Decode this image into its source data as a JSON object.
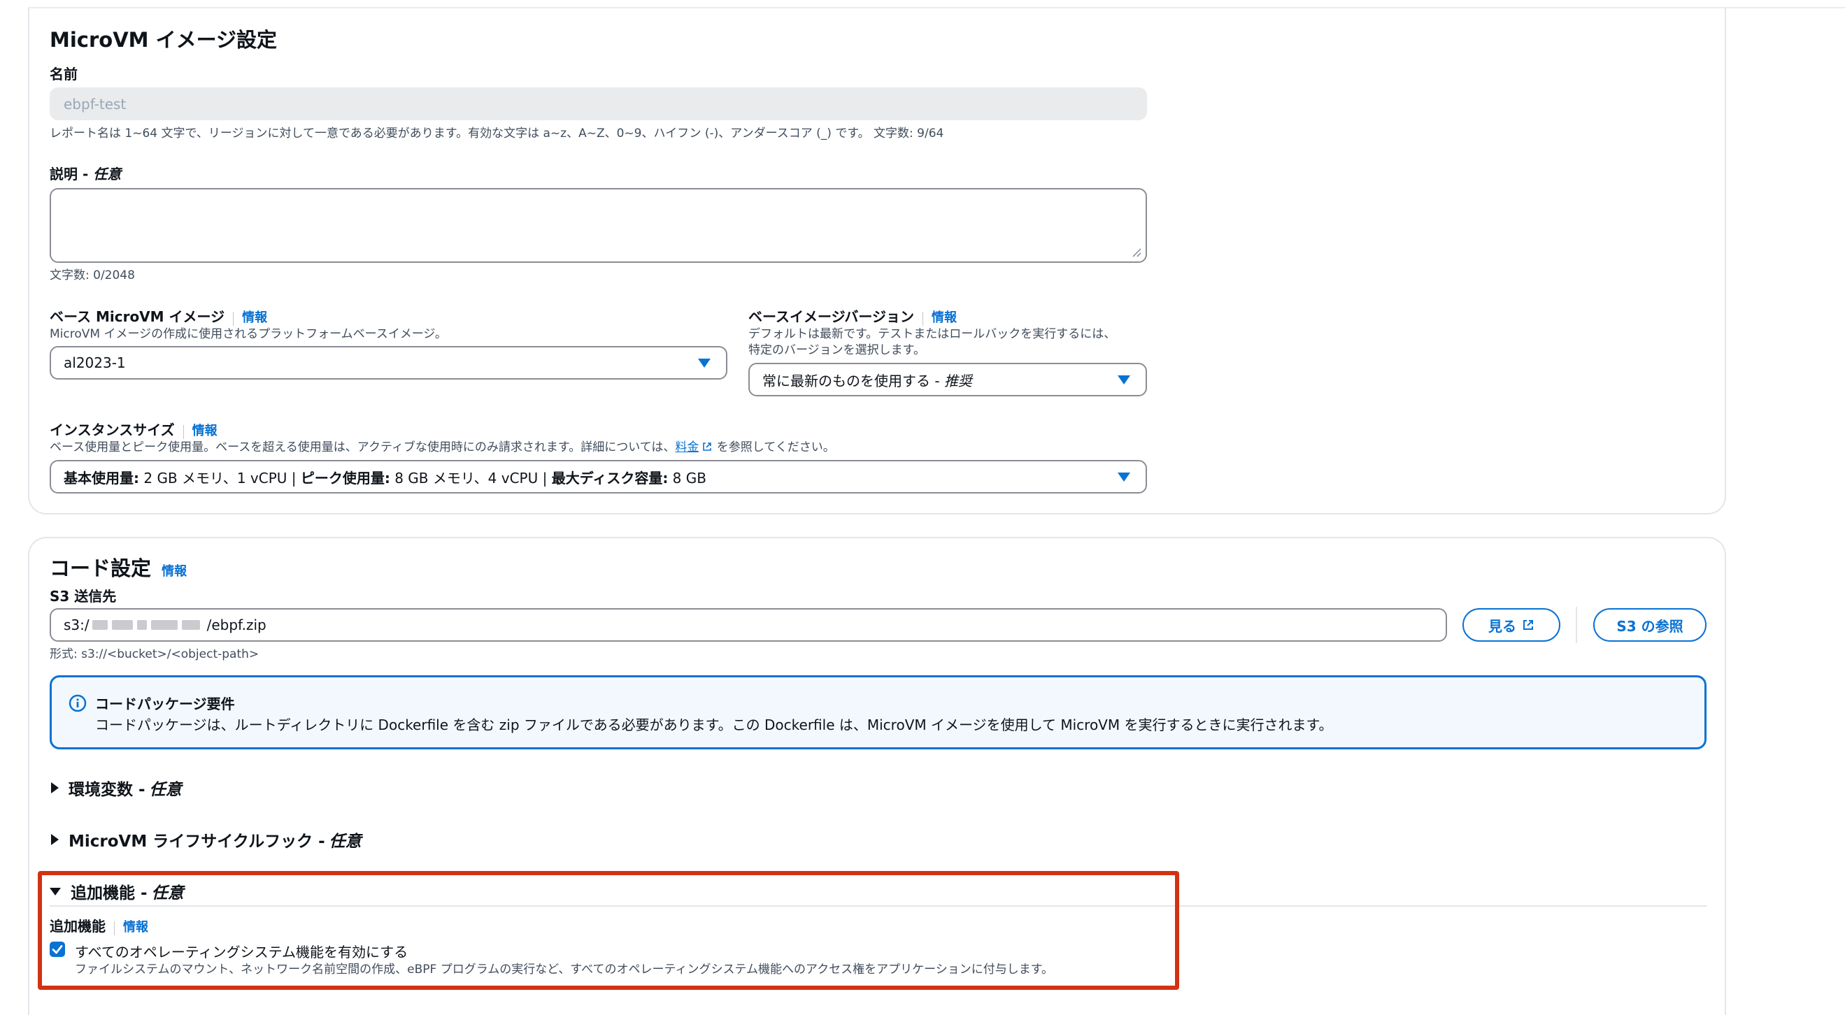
{
  "image_settings": {
    "title": "MicroVM イメージ設定",
    "name_label": "名前",
    "name_value": "ebpf-test",
    "name_hint": "レポート名は 1~64 文字で、リージョンに対して一意である必要があります。有効な文字は a~z、A~Z、0~9、ハイフン (-)、アンダースコア (_) です。 文字数: 9/64",
    "description_label": "説明 - ",
    "description_optional": "任意",
    "description_count": "文字数: 0/2048",
    "base_image_label": "ベース MicroVM イメージ",
    "base_image_info": "情報",
    "base_image_desc": "MicroVM イメージの作成に使用されるプラットフォームベースイメージ。",
    "base_image_value": "al2023-1",
    "base_version_label": "ベースイメージバージョン",
    "base_version_info": "情報",
    "base_version_desc_1": "デフォルトは最新です。テストまたはロールバックを実行するには、",
    "base_version_desc_2": "特定のバージョンを選択します。",
    "base_version_value": "常に最新のものを使用する - ",
    "base_version_value_italic": "推奨",
    "instance_size_label": "インスタンスサイズ",
    "instance_size_info": "情報",
    "instance_size_desc_pre": "ベース使用量とピーク使用量。ベースを超える使用量は、アクティブな使用時にのみ請求されます。詳細については、",
    "instance_size_link": "料金",
    "instance_size_desc_post": " を参照してください。",
    "instance_size_value": {
      "base_label": "基本使用量:",
      "base_value": " 2 GB メモリ、1 vCPU | ",
      "peak_label": "ピーク使用量:",
      "peak_value": " 8 GB メモリ、4 vCPU | ",
      "disk_label": "最大ディスク容量:",
      "disk_value": " 8 GB"
    }
  },
  "code_settings": {
    "title": "コード設定",
    "info": "情報",
    "s3_label": "S3 送信先",
    "s3_prefix": "s3:/",
    "s3_suffix": "/ebpf.zip",
    "s3_format": "形式: s3://<bucket>/<object-path>",
    "view_button": "見る",
    "browse_button": "S3 の参照",
    "alert_title": "コードパッケージ要件",
    "alert_body": "コードパッケージは、ルートディレクトリに Dockerfile を含む zip ファイルである必要があります。この Dockerfile は、MicroVM イメージを使用して MicroVM を実行するときに実行されます。",
    "env_vars": "環境変数 - ",
    "env_vars_optional": "任意",
    "lifecycle_hooks": "MicroVM ライフサイクルフック - ",
    "lifecycle_optional": "任意",
    "additional_features": "追加機能 - ",
    "additional_optional": "任意",
    "additional_label": "追加機能",
    "additional_info": "情報",
    "checkbox_label": "すべてのオペレーティングシステム機能を有効にする",
    "checkbox_checked": true,
    "checkbox_desc": "ファイルシステムのマウント、ネットワーク名前空間の作成、eBPF プログラムの実行など、すべてのオペレーティングシステム機能へのアクセス権をアプリケーションに付与します。"
  },
  "colors": {
    "accent": "#0972d3",
    "highlight_box": "#d13212",
    "alert_bg": "#f2f8fd"
  }
}
